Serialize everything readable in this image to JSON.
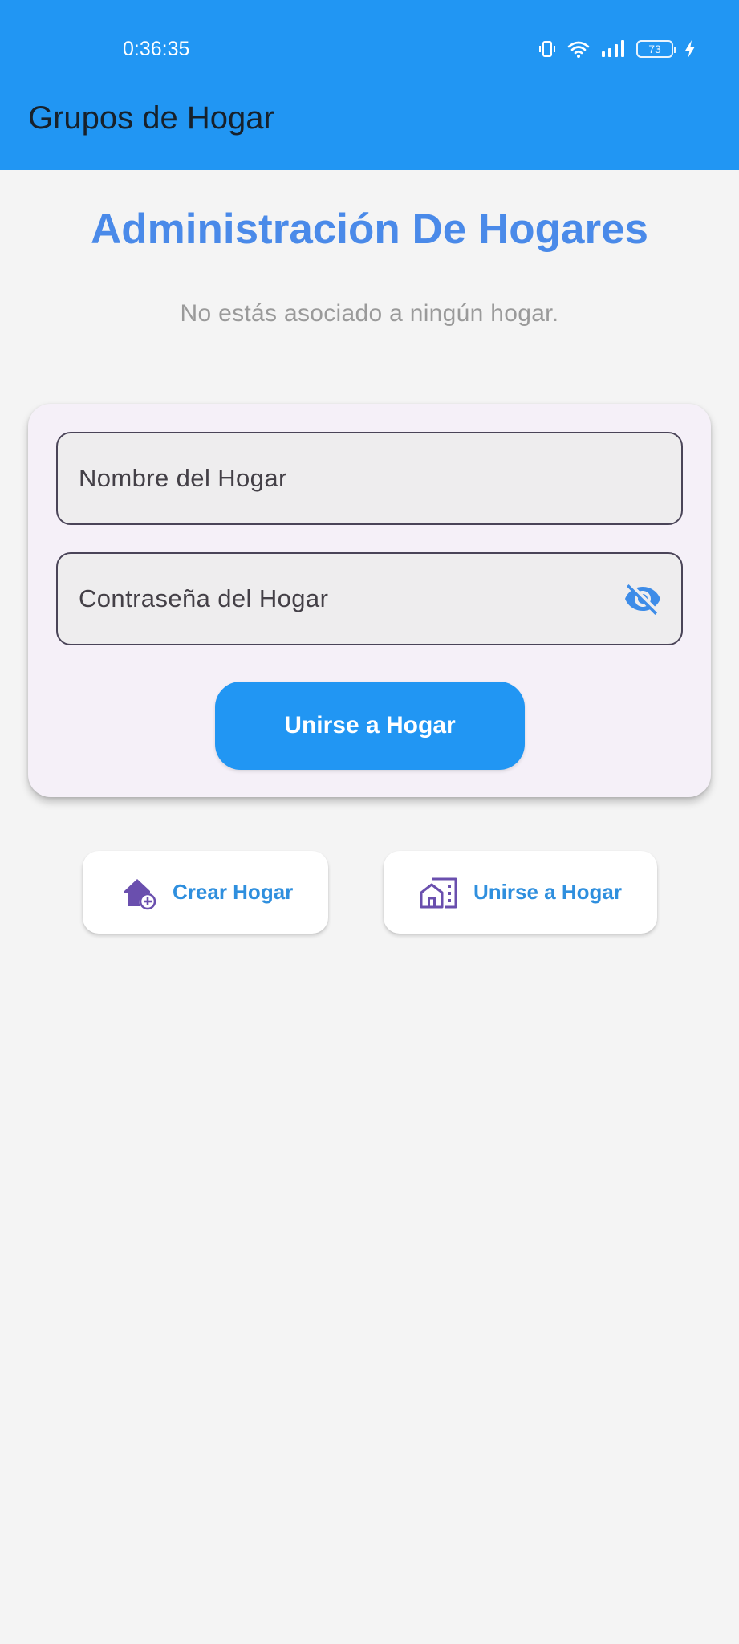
{
  "status_bar": {
    "time": "0:36:35",
    "battery_level": "73",
    "icons": [
      "vibrate-icon",
      "wifi-icon",
      "signal-icon",
      "battery-icon",
      "charging-icon"
    ]
  },
  "app_bar": {
    "title": "Grupos de Hogar"
  },
  "main": {
    "title": "Administración De Hogares",
    "subtitle": "No estás asociado a ningún hogar."
  },
  "form": {
    "name_placeholder": "Nombre del Hogar",
    "password_placeholder": "Contraseña del Hogar",
    "visibility_icon": "visibility-off-icon",
    "submit_label": "Unirse a Hogar"
  },
  "mode_buttons": {
    "create": {
      "label": "Crear Hogar",
      "icon": "add-home-icon"
    },
    "join": {
      "label": "Unirse a Hogar",
      "icon": "home-work-icon"
    }
  },
  "colors": {
    "app_bar": "#2196f3",
    "title": "#4a8ae9",
    "accent_icon": "#6a4fae",
    "link_text": "#2f8fde"
  }
}
